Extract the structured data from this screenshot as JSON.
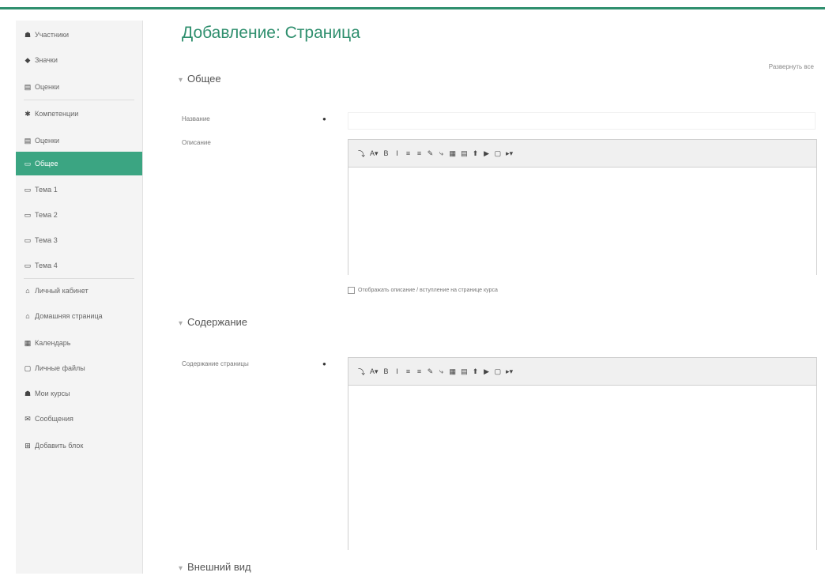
{
  "sidebar": {
    "items": [
      {
        "label": "Участники",
        "icon": "users-icon",
        "glyph": "☗"
      },
      {
        "label": "Значки",
        "icon": "badge-icon",
        "glyph": "◆"
      },
      {
        "label": "Оценки",
        "icon": "grades-icon",
        "glyph": "▤"
      },
      {
        "label": "Компетенции",
        "icon": "competency-icon",
        "glyph": "✱"
      },
      {
        "label": "Оценки",
        "icon": "grades-icon",
        "glyph": "▤"
      },
      {
        "label": "Общее",
        "icon": "folder-icon",
        "glyph": "▭",
        "active": true
      },
      {
        "label": "Тема 1",
        "icon": "folder-icon",
        "glyph": "▭"
      },
      {
        "label": "Тема 2",
        "icon": "folder-icon",
        "glyph": "▭"
      },
      {
        "label": "Тема 3",
        "icon": "folder-icon",
        "glyph": "▭"
      },
      {
        "label": "Тема 4",
        "icon": "folder-icon",
        "glyph": "▭"
      },
      {
        "label": "Личный кабинет",
        "icon": "home-icon",
        "glyph": "⌂"
      },
      {
        "label": "Домашняя страница",
        "icon": "home-icon",
        "glyph": "⌂"
      },
      {
        "label": "Календарь",
        "icon": "calendar-icon",
        "glyph": "▦"
      },
      {
        "label": "Личные файлы",
        "icon": "file-icon",
        "glyph": "▢"
      },
      {
        "label": "Мои курсы",
        "icon": "courses-icon",
        "glyph": "☗"
      },
      {
        "label": "Сообщения",
        "icon": "messages-icon",
        "glyph": "✉"
      },
      {
        "label": "Добавить блок",
        "icon": "plus-square-icon",
        "glyph": "⊞"
      }
    ]
  },
  "main": {
    "title": "Добавление: Страница",
    "expand_all": "Развернуть все",
    "sections": {
      "general": "Общее",
      "content": "Содержание",
      "appearance": "Внешний вид"
    },
    "fields": {
      "name_label": "Название",
      "description_label": "Описание",
      "page_content_label": "Содержание страницы",
      "show_description": "Отображать описание / вступление на странице курса"
    },
    "toolbar": [
      "⤵",
      "A▾",
      "B",
      "I",
      "≡",
      "≡",
      "✎",
      "⤷",
      "▦",
      "▤",
      "⬆",
      "▶",
      "▢",
      "▸▾"
    ]
  }
}
